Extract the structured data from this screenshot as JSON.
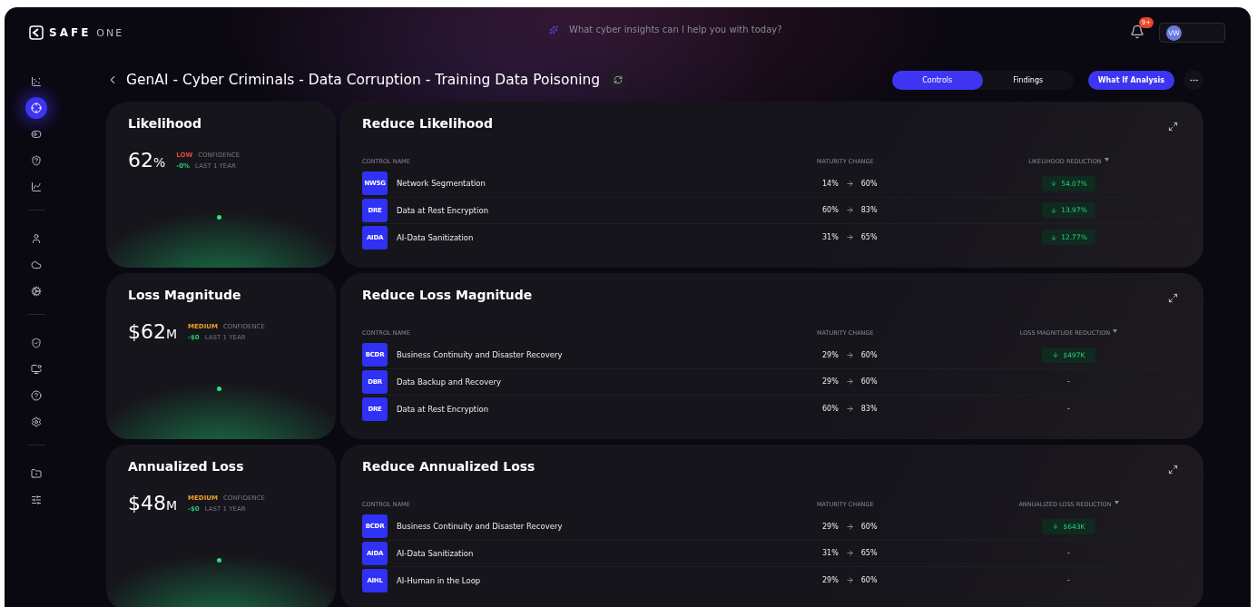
{
  "brand": {
    "name": "SAFE",
    "suffix": "ONE"
  },
  "search": {
    "placeholder": "What cyber insights can I help you with today?"
  },
  "notifications": {
    "count": "9+"
  },
  "user": {
    "initials": "VW"
  },
  "sidebar": {
    "groups": [
      [
        {
          "selected": false
        },
        {
          "selected": true
        },
        {
          "selected": false
        },
        {
          "selected": false
        },
        {
          "selected": false
        }
      ],
      [
        {
          "selected": false
        },
        {
          "selected": false
        },
        {
          "selected": false
        }
      ],
      [
        {
          "selected": false
        },
        {
          "selected": false
        },
        {
          "selected": false
        },
        {
          "selected": false
        }
      ],
      [
        {
          "selected": false
        },
        {
          "selected": false
        }
      ]
    ]
  },
  "page": {
    "title": "GenAI - Cyber Criminals - Data Corruption - Training Data Poisoning"
  },
  "tabs": [
    {
      "label": "Controls",
      "selected": true
    },
    {
      "label": "Findings",
      "selected": false
    }
  ],
  "action_button": "What If Analysis",
  "sections": [
    {
      "metric": {
        "title": "Likelihood",
        "value": "62",
        "unit": "%",
        "confidence": {
          "label": "LOW",
          "kind": "low"
        },
        "confidence_label": "CONFIDENCE",
        "change": "-0%",
        "period": "LAST 1 YEAR"
      },
      "table": {
        "title": "Reduce Likelihood",
        "columns": [
          "CONTROL NAME",
          "MATURITY CHANGE",
          "LIKELIHOOD REDUCTION"
        ],
        "rows": [
          {
            "code": "NWSG",
            "name": "Network Segmentation",
            "from": "14%",
            "to": "60%",
            "reduction": {
              "kind": "badge",
              "text": "54.07%"
            }
          },
          {
            "code": "DRE",
            "name": "Data at Rest Encryption",
            "from": "60%",
            "to": "83%",
            "reduction": {
              "kind": "badge",
              "text": "13.97%"
            }
          },
          {
            "code": "AIDA",
            "name": "AI-Data Sanitization",
            "from": "31%",
            "to": "65%",
            "reduction": {
              "kind": "badge",
              "text": "12.77%"
            }
          }
        ]
      }
    },
    {
      "metric": {
        "title": "Loss Magnitude",
        "prefix": "$",
        "value": "62",
        "unit": "M",
        "confidence": {
          "label": "MEDIUM",
          "kind": "medium"
        },
        "confidence_label": "CONFIDENCE",
        "change": "-$0",
        "period": "LAST 1 YEAR"
      },
      "table": {
        "title": "Reduce Loss Magnitude",
        "columns": [
          "CONTROL NAME",
          "MATURITY CHANGE",
          "LOSS MAGNITUDE REDUCTION"
        ],
        "rows": [
          {
            "code": "BCDR",
            "name": "Business Continuity and Disaster Recovery",
            "from": "29%",
            "to": "60%",
            "reduction": {
              "kind": "badge",
              "text": "$497K"
            }
          },
          {
            "code": "DBR",
            "name": "Data Backup and Recovery",
            "from": "29%",
            "to": "60%",
            "reduction": {
              "kind": "plain",
              "text": "-"
            }
          },
          {
            "code": "DRE",
            "name": "Data at Rest Encryption",
            "from": "60%",
            "to": "83%",
            "reduction": {
              "kind": "plain",
              "text": "-"
            }
          }
        ]
      }
    },
    {
      "metric": {
        "title": "Annualized Loss",
        "prefix": "$",
        "value": "48",
        "unit": "M",
        "confidence": {
          "label": "MEDIUM",
          "kind": "medium"
        },
        "confidence_label": "CONFIDENCE",
        "change": "-$0",
        "period": "LAST 1 YEAR"
      },
      "table": {
        "title": "Reduce Annualized Loss",
        "columns": [
          "CONTROL NAME",
          "MATURITY CHANGE",
          "ANNUALIZED LOSS REDUCTION"
        ],
        "rows": [
          {
            "code": "BCDR",
            "name": "Business Continuity and Disaster Recovery",
            "from": "29%",
            "to": "60%",
            "reduction": {
              "kind": "badge",
              "text": "$643K"
            }
          },
          {
            "code": "AIDA",
            "name": "AI-Data Sanitization",
            "from": "31%",
            "to": "65%",
            "reduction": {
              "kind": "plain",
              "text": "-"
            }
          },
          {
            "code": "AIHL",
            "name": "AI-Human in the Loop",
            "from": "29%",
            "to": "60%",
            "reduction": {
              "kind": "plain",
              "text": "-"
            }
          }
        ]
      }
    }
  ]
}
